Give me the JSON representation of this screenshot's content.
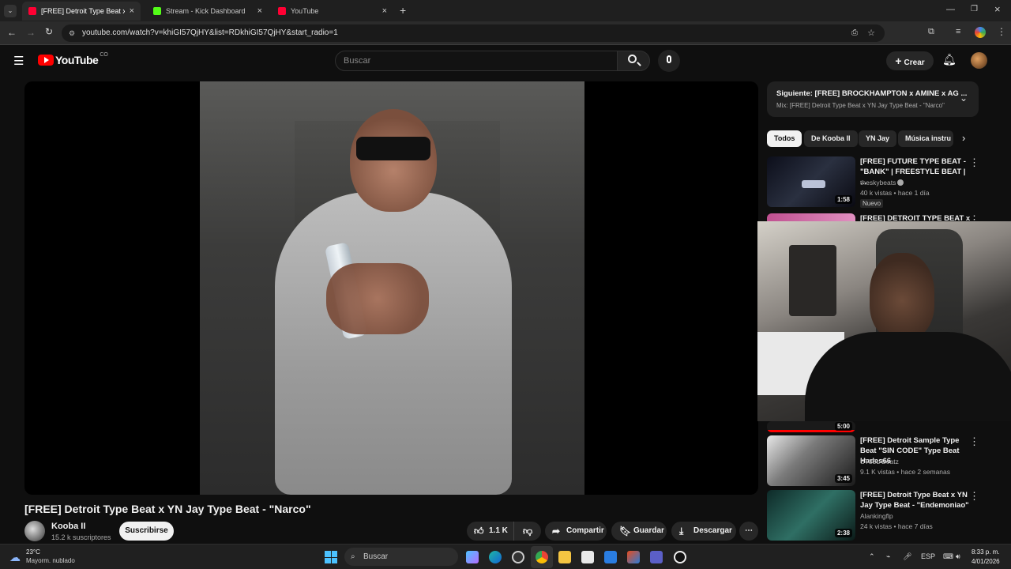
{
  "browser": {
    "tabs": [
      {
        "title": "[FREE] Detroit Type Beat x YN J",
        "color": "#ff0033"
      },
      {
        "title": "Stream - Kick Dashboard",
        "color": "#53fc18"
      },
      {
        "title": "YouTube",
        "color": "#ff0033"
      }
    ],
    "url": "youtube.com/watch?v=khiGI57QjHY&list=RDkhiGI57QjHY&start_radio=1"
  },
  "yt": {
    "logo": "YouTube",
    "region": "CO",
    "search_placeholder": "Buscar",
    "create_label": "Crear"
  },
  "video": {
    "title": "[FREE] Detroit Type Beat x YN Jay Type Beat - \"Narco\"",
    "channel": "Kooba II",
    "subscribers": "15.2 k suscriptores",
    "subscribe_label": "Suscribirse",
    "likes": "1.1 K",
    "share_label": "Compartir",
    "save_label": "Guardar",
    "download_label": "Descargar"
  },
  "upnext": {
    "title": "Siguiente: [FREE] BROCKHAMPTON x AMINE x AG ...",
    "subtitle": "Mix: [FREE] Detroit Type Beat x YN Jay Type Beat - \"Narco\""
  },
  "chips": [
    "Todos",
    "De Kooba II",
    "YN Jay",
    "Música instru"
  ],
  "recommendations": [
    {
      "title": "[FREE] FUTURE TYPE BEAT - \"BANK\" | FREESTYLE BEAT | ...",
      "channel": "theskybeats",
      "meta": "40 k vistas • hace 1 día",
      "badge": "Nuevo",
      "duration": "1:58"
    },
    {
      "title": "[FREE] DETROIT TYPE BEAT x",
      "channel": "",
      "meta": "",
      "badge": "",
      "duration": ""
    },
    {
      "title": "",
      "channel": "",
      "meta": "",
      "badge": "",
      "duration": "5:00"
    },
    {
      "title": "[FREE] Detroit Sample Type Beat \"SIN CODE\" Type Beat Hades66",
      "channel": "ST33L Beatz",
      "meta": "9.1 K vistas • hace 2 semanas",
      "badge": "",
      "duration": "3:45"
    },
    {
      "title": "[FREE] Detroit Type Beat x YN Jay Type Beat - \"Endemoniao\"",
      "channel": "Alankingflp",
      "meta": "24 k vistas • hace 7 días",
      "badge": "",
      "duration": "2:38"
    }
  ],
  "taskbar": {
    "weather_temp": "23°C",
    "weather_desc": "Mayorm. nublado",
    "search_label": "Buscar",
    "lang": "ESP",
    "time": "8:33 p. m.",
    "date": "4/01/2026"
  }
}
